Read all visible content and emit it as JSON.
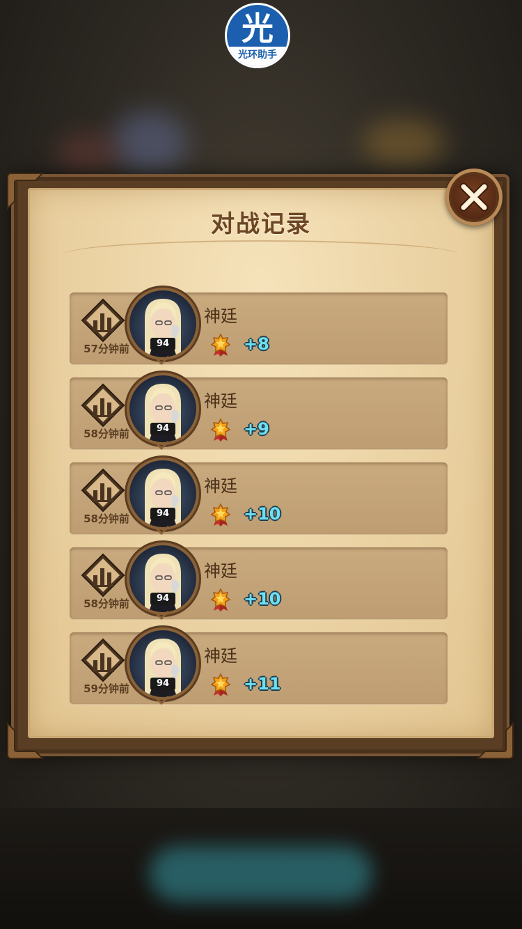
{
  "watermark": {
    "glyph": "光",
    "text": "光环助手"
  },
  "panel": {
    "title": "对战记录"
  },
  "close": {
    "icon": "close-icon"
  },
  "colors": {
    "score": "#6ee0f0",
    "panel": "#ecd4a6",
    "frame": "#5a3e24"
  },
  "records": [
    {
      "time": "57分钟前",
      "name": "神廷",
      "level": "94",
      "score": "+8"
    },
    {
      "time": "58分钟前",
      "name": "神廷",
      "level": "94",
      "score": "+9"
    },
    {
      "time": "58分钟前",
      "name": "神廷",
      "level": "94",
      "score": "+10"
    },
    {
      "time": "58分钟前",
      "name": "神廷",
      "level": "94",
      "score": "+10"
    },
    {
      "time": "59分钟前",
      "name": "神廷",
      "level": "94",
      "score": "+11"
    }
  ]
}
